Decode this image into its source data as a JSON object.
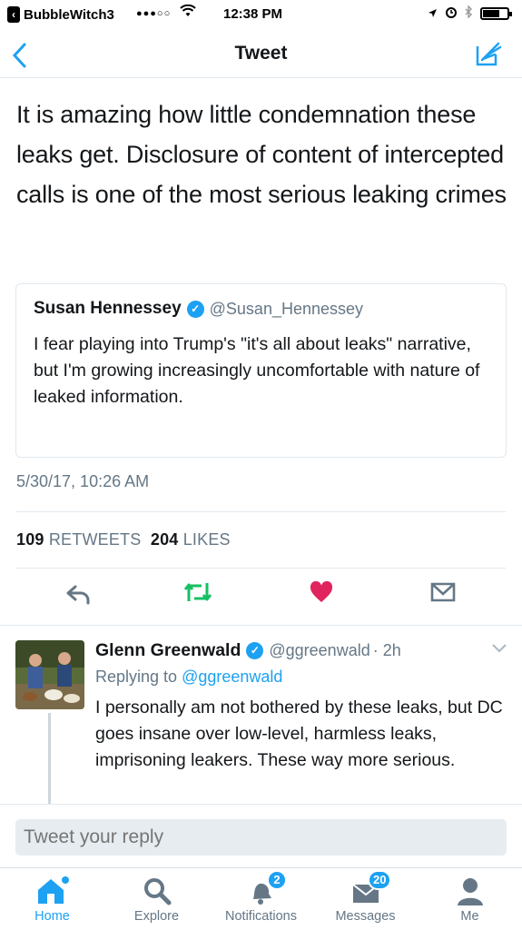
{
  "status_bar": {
    "app_back": "BubbleWitch3",
    "signal": "●●●○○",
    "time": "12:38 PM"
  },
  "nav": {
    "title": "Tweet",
    "back_icon": "chevron-left-icon",
    "compose_icon": "compose-icon"
  },
  "tweet": {
    "text": "It is amazing how little condemnation these leaks get. Disclosure of content of intercepted calls is one of the most serious leaking crimes",
    "quoted": {
      "name": "Susan Hennessey",
      "handle": "@Susan_Hennessey",
      "text": "I fear playing into Trump's \"it's all about leaks\" narrative, but I'm growing increasingly uncomfortable with nature of leaked information."
    },
    "timestamp": "5/30/17, 10:26 AM",
    "stats": {
      "retweets_count": "109",
      "retweets_label": "RETWEETS",
      "likes_count": "204",
      "likes_label": "LIKES"
    }
  },
  "reply": {
    "name": "Glenn Greenwald",
    "handle": "@ggreenwald",
    "time": "· 2h",
    "replying_prefix": "Replying to",
    "replying_to": "@ggreenwald",
    "text": "I personally am not bothered by these leaks, but DC goes insane over low-level, harmless leaks, imprisoning leakers. These way more serious."
  },
  "reply_box": {
    "placeholder": "Tweet your reply"
  },
  "tabs": [
    {
      "label": "Home",
      "icon": "home-icon",
      "active": true
    },
    {
      "label": "Explore",
      "icon": "search-icon"
    },
    {
      "label": "Notifications",
      "icon": "bell-icon",
      "badge": "2"
    },
    {
      "label": "Messages",
      "icon": "envelope-icon",
      "badge": "20"
    },
    {
      "label": "Me",
      "icon": "person-icon"
    }
  ],
  "colors": {
    "accent": "#1da1f2",
    "retweet": "#17bf63",
    "like": "#e0245e",
    "muted": "#657786"
  }
}
